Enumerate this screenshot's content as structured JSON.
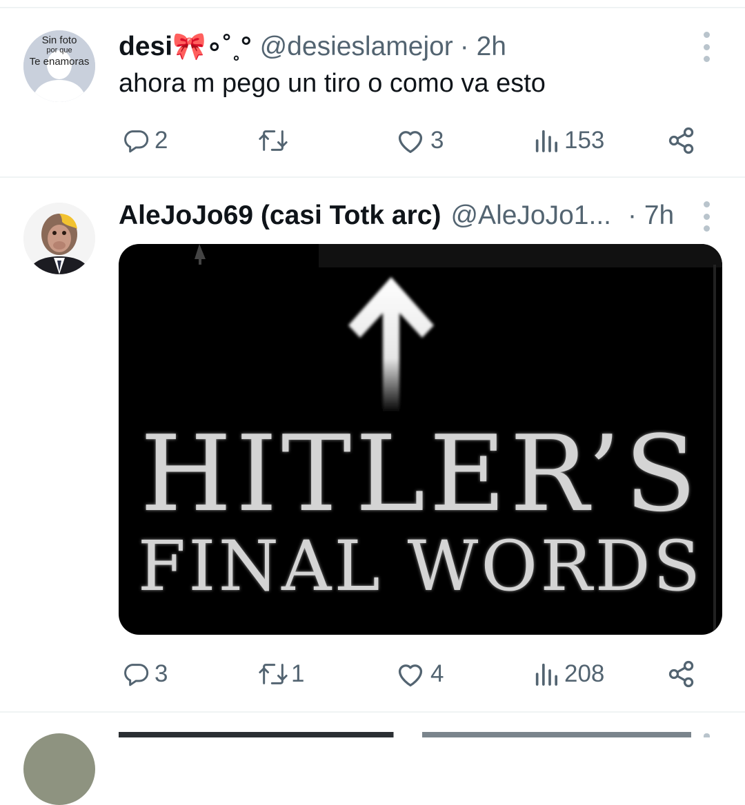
{
  "tweets": [
    {
      "avatar_text": [
        "Sin foto",
        "por que",
        "Te enamoras"
      ],
      "name": "desi🎀∘˚˳°",
      "handle": "@desieslamejor",
      "time": "· 2h",
      "text": "ahora m pego un tiro o como va esto",
      "replies": "2",
      "retweets": "",
      "likes": "3",
      "views": "153"
    },
    {
      "name": "AleJoJo69 (casi Totk arc)",
      "handle": "@AleJoJo1...",
      "time": "· 7h",
      "media_text": {
        "line1": "HITLER’S",
        "line2": "FINAL WORDS"
      },
      "replies": "3",
      "retweets": "1",
      "likes": "4",
      "views": "208"
    }
  ],
  "icons": [
    "reply-icon",
    "retweet-icon",
    "like-icon",
    "views-icon",
    "share-icon",
    "more-icon",
    "arrow-up-icon"
  ],
  "colors": {
    "text": "#0f1419",
    "secondary": "#536471",
    "divider": "#eff3f4"
  }
}
